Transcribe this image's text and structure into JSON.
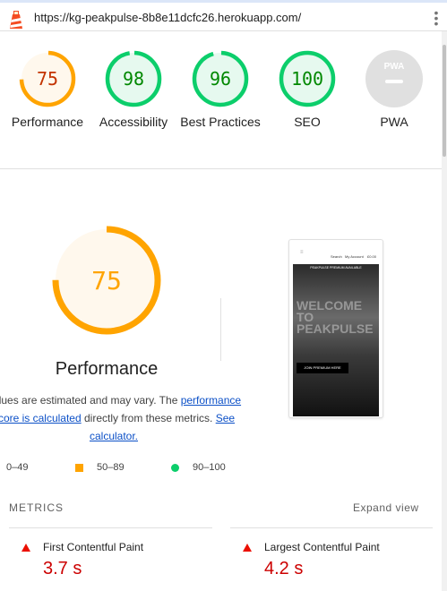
{
  "header": {
    "url": "https://kg-peakpulse-8b8e11dcfc26.herokuapp.com/"
  },
  "scores": [
    {
      "label": "Performance",
      "value": "75",
      "score": 75,
      "color": "#ffa400",
      "bg": "#fff8ed",
      "text": "#c33300"
    },
    {
      "label": "Accessibility",
      "value": "98",
      "score": 98,
      "color": "#0cce6b",
      "bg": "#e6f9ef",
      "text": "#008800"
    },
    {
      "label": "Best Practices",
      "value": "96",
      "score": 96,
      "color": "#0cce6b",
      "bg": "#e6f9ef",
      "text": "#008800"
    },
    {
      "label": "SEO",
      "value": "100",
      "score": 100,
      "color": "#0cce6b",
      "bg": "#e6f9ef",
      "text": "#008800"
    },
    {
      "label": "PWA",
      "value": "PWA",
      "score": null,
      "color": "#e0e0e0",
      "bg": "#e0e0e0",
      "text": "#bdbdbd"
    }
  ],
  "main": {
    "score": "75",
    "score_value": 75,
    "title": "Performance",
    "note_1": "Values are estimated and may vary. The ",
    "note_link1": "performance score is calculated",
    "note_2": " directly from these metrics. ",
    "note_link2": "See calculator.",
    "legend": [
      "0–49",
      "50–89",
      "90–100"
    ]
  },
  "screenshot": {
    "nav": [
      "Search",
      "My Account",
      "£0.00"
    ],
    "banner": "PEAKPULSE PREMIUM AVAILABLE",
    "welcome": "WELCOME TO PEAKPULSE",
    "cta": "JOIN PREMIUM HERE"
  },
  "metrics": {
    "heading": "METRICS",
    "expand": "Expand view",
    "items": [
      {
        "name": "First Contentful Paint",
        "value": "3.7 s"
      },
      {
        "name": "Largest Contentful Paint",
        "value": "4.2 s"
      }
    ]
  }
}
